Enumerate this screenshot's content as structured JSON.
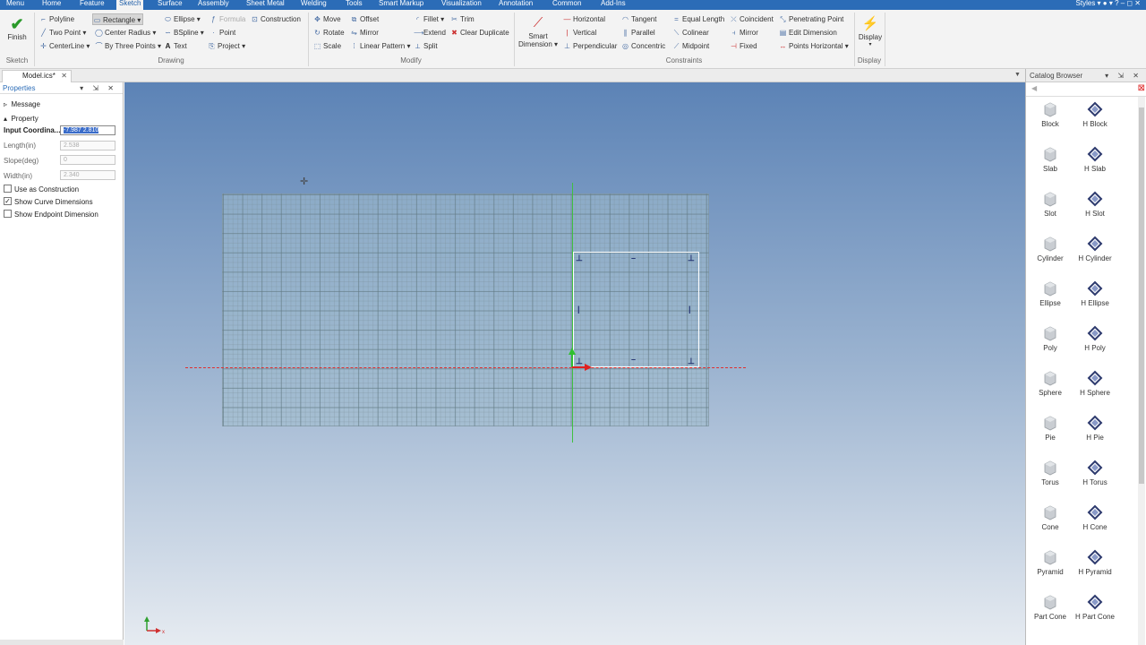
{
  "menu": {
    "tabs": [
      "Menu",
      "Home",
      "Feature",
      "Sketch",
      "Surface",
      "Assembly",
      "Sheet Metal",
      "Welding",
      "Tools",
      "Smart Markup",
      "Visualization",
      "Annotation",
      "Common",
      "Add-Ins"
    ],
    "active": "Sketch",
    "right": "Styles"
  },
  "ribbon": {
    "finish": "Finish",
    "drawing": {
      "polyline": "Polyline",
      "rectangle": "Rectangle",
      "ellipse": "Ellipse",
      "formula": "Formula",
      "construction": "Construction",
      "two_point": "Two Point",
      "center_radius": "Center Radius",
      "bspline": "BSpline",
      "point": "Point",
      "centerline": "CenterLine",
      "by_three_points": "By Three Points",
      "text": "Text",
      "project": "Project"
    },
    "modify": {
      "move": "Move",
      "offset": "Offset",
      "fillet": "Fillet",
      "trim": "Trim",
      "rotate": "Rotate",
      "mirror": "Mirror",
      "extend": "Extend",
      "clear_duplicate": "Clear Duplicate",
      "scale": "Scale",
      "linear_pattern": "Linear Pattern",
      "split": "Split"
    },
    "smart_dimension": [
      "Smart",
      "Dimension"
    ],
    "constraints": {
      "horizontal": "Horizontal",
      "tangent": "Tangent",
      "equal_length": "Equal Length",
      "coincident": "Coincident",
      "penetrating_point": "Penetrating Point",
      "vertical": "Vertical",
      "parallel": "Parallel",
      "colinear": "Colinear",
      "mirror": "Mirror",
      "edit_dimension": "Edit Dimension",
      "perpendicular": "Perpendicular",
      "concentric": "Concentric",
      "midpoint": "Midpoint",
      "fixed": "Fixed",
      "points_horizontal": "Points Horizontal"
    },
    "display": "Display",
    "groups": {
      "sketch": "Sketch",
      "drawing": "Drawing",
      "modify": "Modify",
      "constraints": "Constraints",
      "display": "Display"
    }
  },
  "document": {
    "tab": "Model.ics*"
  },
  "properties": {
    "title": "Properties",
    "message": "Message",
    "property": "Property",
    "fields": [
      {
        "label": "Input Coordina...",
        "value": "-7.987 2.810",
        "active": true
      },
      {
        "label": "Length(in)",
        "value": "2.538",
        "active": false
      },
      {
        "label": "Slope(deg)",
        "value": "0",
        "active": false
      },
      {
        "label": "Width(in)",
        "value": "2.340",
        "active": false
      }
    ],
    "checks": [
      {
        "label": "Use as Construction",
        "checked": false
      },
      {
        "label": "Show Curve Dimensions",
        "checked": true
      },
      {
        "label": "Show Endpoint Dimension",
        "checked": false
      }
    ]
  },
  "catalog": {
    "title": "Catalog Browser",
    "items": [
      [
        "Block",
        "H Block"
      ],
      [
        "Slab",
        "H Slab"
      ],
      [
        "Slot",
        "H Slot"
      ],
      [
        "Cylinder",
        "H Cylinder"
      ],
      [
        "Ellipse",
        "H Ellipse"
      ],
      [
        "Poly",
        "H Poly"
      ],
      [
        "Sphere",
        "H Sphere"
      ],
      [
        "Pie",
        "H Pie"
      ],
      [
        "Torus",
        "H Torus"
      ],
      [
        "Cone",
        "H Cone"
      ],
      [
        "Pyramid",
        "H Pyramid"
      ],
      [
        "Part Cone",
        "H Part Cone"
      ]
    ]
  },
  "viewport": {
    "triad_x": "x"
  }
}
